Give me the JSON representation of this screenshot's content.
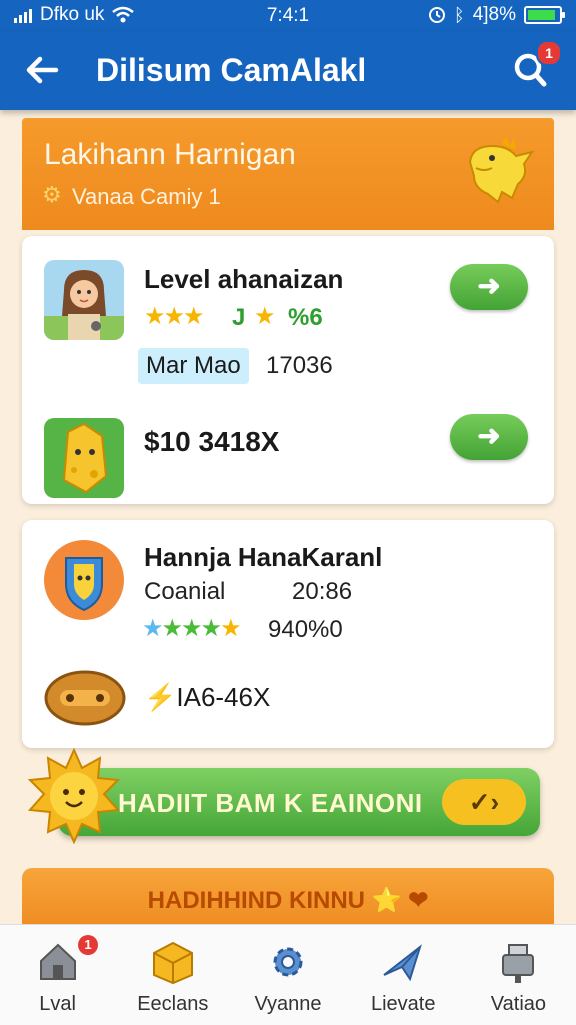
{
  "status_bar": {
    "carrier": "Dfko uk",
    "time": "7:4:1",
    "battery": "4]8%",
    "battery_level": 0.9
  },
  "app_bar": {
    "title": "Dilisum CamAlakl",
    "badge_count": "1"
  },
  "header": {
    "title": "Lakihann Harnigan",
    "subtitle": "Vanaa Camiy 1"
  },
  "card1": {
    "title": "Level ahanaizan",
    "rating_text": "J",
    "rating_value": "%6",
    "tag": "Mar Mao",
    "tag_value": "17036",
    "price": "$10 3418X",
    "action_icon": "arrow-right-icon"
  },
  "card2": {
    "title": "Hannja HanaKaranl",
    "label": "Coanial",
    "label_value": "20:86",
    "rating_value": "940%0",
    "price": "⚡IA6-46X"
  },
  "cta": {
    "label": "HADIIT BAM K EAINONI",
    "button": "✓›"
  },
  "promo": {
    "label": "HADIHHIND KINNU ⭐ ❤"
  },
  "bottom_nav": {
    "items": [
      {
        "label": "Lval",
        "icon": "house-icon",
        "badge": "1"
      },
      {
        "label": "Eeclans",
        "icon": "box-icon"
      },
      {
        "label": "Vyanne",
        "icon": "gear-icon"
      },
      {
        "label": "Lievate",
        "icon": "plane-icon"
      },
      {
        "label": "Vatiao",
        "icon": "mailbox-icon"
      }
    ]
  },
  "colors": {
    "primary": "#1565c0",
    "accent_orange": "#f59a2b",
    "accent_green": "#4caf50",
    "background": "#fbeedc"
  }
}
